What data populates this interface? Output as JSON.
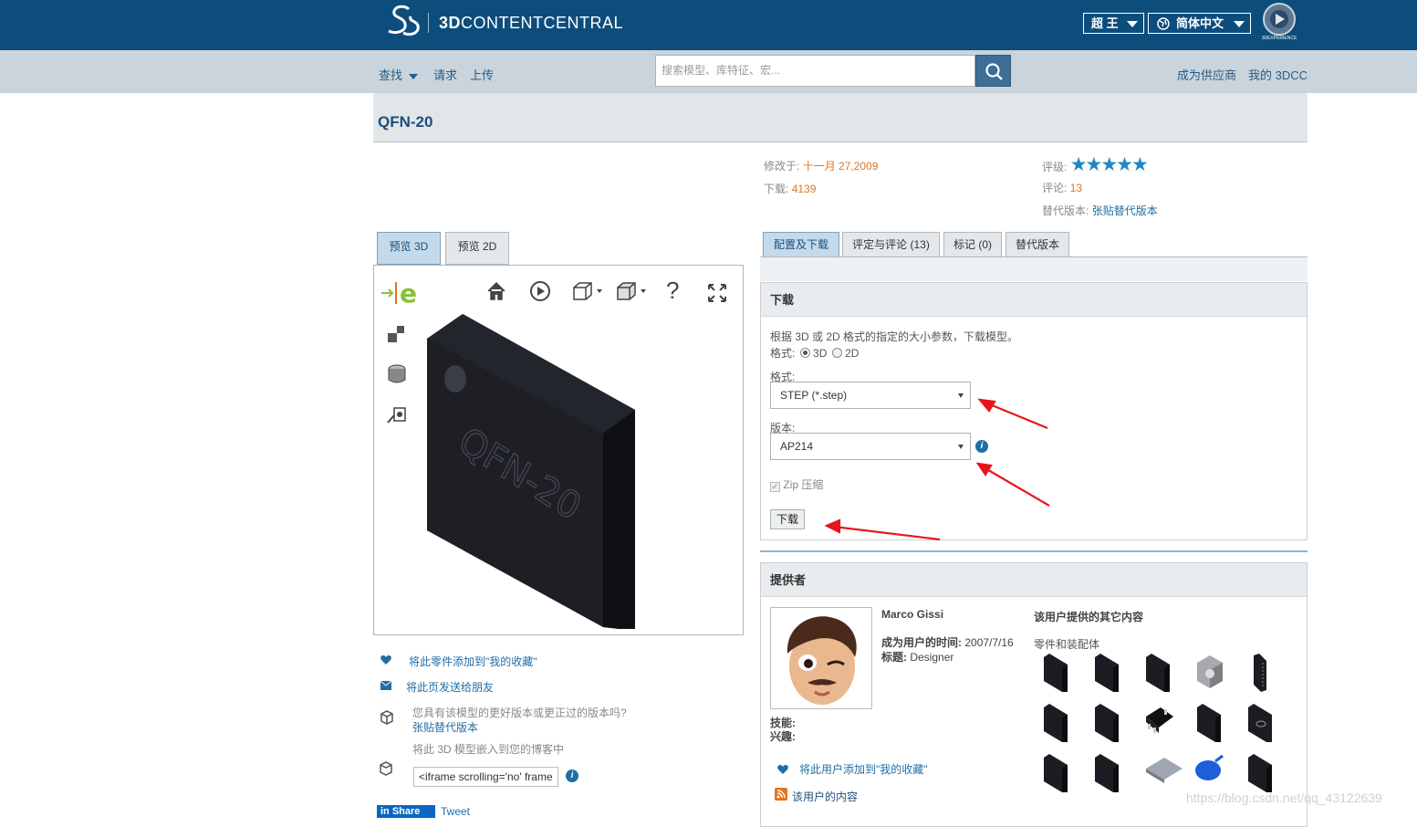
{
  "header": {
    "brand_bold": "3D",
    "brand_rest": "CONTENTCENTRAL",
    "user_menu": "超 王",
    "language_menu": "简体中文",
    "experience_label": "3DEXPERIENCE"
  },
  "nav": {
    "find": "查找",
    "request": "请求",
    "upload": "上传",
    "search_placeholder": "搜索模型、库特征、宏...",
    "become_supplier": "成为供应商",
    "my_3dcc": "我的 3DCC"
  },
  "part": {
    "title": "QFN-20",
    "modified_label": "修改于:",
    "modified_value": "十一月 27,2009",
    "downloads_label": "下载:",
    "downloads_value": "4139",
    "rating_label": "评级:",
    "rating_value": 5,
    "reviews_label": "评论:",
    "reviews_value": "13",
    "alt_label": "替代版本:",
    "alt_link": "张贴替代版本",
    "model_text": "QFN-20"
  },
  "preview_tabs": [
    {
      "label": "预览 3D",
      "active": true
    },
    {
      "label": "预览 2D",
      "active": false
    }
  ],
  "main_tabs": [
    {
      "label": "配置及下载",
      "active": true
    },
    {
      "label": "评定与评论 (13)",
      "active": false
    },
    {
      "label": "标记 (0)",
      "active": false
    },
    {
      "label": "替代版本",
      "active": false
    }
  ],
  "download": {
    "heading": "下载",
    "intro": "根据 3D 或 2D 格式的指定的大小参数，下载模型。",
    "format_radio_label": "格式:",
    "radio_3d": "3D",
    "radio_2d": "2D",
    "format_label": "格式:",
    "format_value": "STEP (*.step)",
    "version_label": "版本:",
    "version_value": "AP214",
    "zip_label": "Zip 压缩",
    "button": "下载"
  },
  "left_actions": {
    "add_favorite": "将此零件添加到\"我的收藏\"",
    "send_friend": "将此页发送给朋友",
    "better_version_q": "您具有该模型的更好版本或更正过的版本吗?",
    "post_alt": "张贴替代版本",
    "embed_text": "将此 3D 模型嵌入到您的博客中",
    "embed_code": "<iframe scrolling='no' frame",
    "share": "Share",
    "tweet": "Tweet"
  },
  "provider": {
    "heading": "提供者",
    "name": "Marco Gissi",
    "member_since_label": "成为用户的时间:",
    "member_since_value": "2007/7/16",
    "title_label": "标题:",
    "title_value": "Designer",
    "skills_label": "技能:",
    "interests_label": "兴趣:",
    "other_content": "该用户提供的其它内容",
    "parts_label": "零件和装配体",
    "add_favorite": "将此用户添加到\"我的收藏\"",
    "user_content": "该用户的内容"
  },
  "watermark": "https://blog.csdn.net/qq_43122639",
  "colors": {
    "header_bg": "#0d4d7c",
    "nav_bg": "#c9d4dc",
    "accent_orange": "#e0751f",
    "link_blue": "#1f6ea5",
    "star_blue": "#2186c8",
    "arrow_red": "#e8141c"
  }
}
